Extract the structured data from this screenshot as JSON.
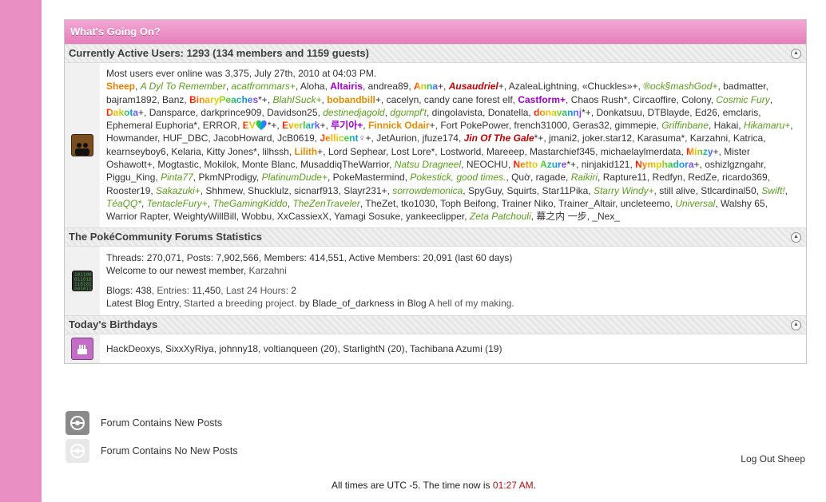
{
  "wgo": {
    "title": "What's Going On?",
    "active": {
      "header": "Currently Active Users: 1293 (134 members and 1159 guests)",
      "most_online": "Most users ever online was 3,375, July 27th, 2010 at 04:03 PM.",
      "users": [
        {
          "n": "Sheep",
          "s": "c-staff"
        },
        {
          "n": "A Dyl To Remember",
          "s": "c-green"
        },
        {
          "n": "acatfrommars+",
          "s": "c-green"
        },
        {
          "n": "Aloha",
          "s": "c-plain"
        },
        {
          "n": "Altairis",
          "s": "c-purple"
        },
        {
          "n": "andrea89",
          "s": "c-plain"
        },
        {
          "n": "Anna",
          "s": "rainbow",
          "x": "+"
        },
        {
          "n": "Ausaudriel",
          "s": "c-red",
          "x": "+"
        },
        {
          "n": "AzaleaLightning",
          "s": "c-plain"
        },
        {
          "n": "«Chuckles»+",
          "s": "c-plain"
        },
        {
          "n": "®ock§mashGod+",
          "s": "c-green"
        },
        {
          "n": "badmatter",
          "s": "c-plain"
        },
        {
          "n": "bajram1892",
          "s": "c-plain"
        },
        {
          "n": "Banz",
          "s": "c-plain"
        },
        {
          "n": "BinaryPeaches",
          "s": "rainbow",
          "x": "*+"
        },
        {
          "n": "BlahISuck+",
          "s": "c-green"
        },
        {
          "n": "bobandbill",
          "s": "c-orange",
          "x": "+"
        },
        {
          "n": "cacelyn",
          "s": "c-plain"
        },
        {
          "n": "candy cane forest elf",
          "s": "c-plain"
        },
        {
          "n": "Castform+",
          "s": "c-purple"
        },
        {
          "n": "Chaos Rush*",
          "s": "c-plain"
        },
        {
          "n": "Circaoffire",
          "s": "c-plain"
        },
        {
          "n": "Colony",
          "s": "c-plain"
        },
        {
          "n": "Cosmic Fury",
          "s": "c-green"
        },
        {
          "n": "Dakota",
          "s": "rainbow",
          "x": "+"
        },
        {
          "n": "Dansparce",
          "s": "c-plain"
        },
        {
          "n": "darkprince909",
          "s": "c-plain"
        },
        {
          "n": "Davidson25",
          "s": "c-plain"
        },
        {
          "n": "destinedjagold",
          "s": "c-green"
        },
        {
          "n": "dɡʊmpf't",
          "s": "c-green"
        },
        {
          "n": "dingolavista",
          "s": "c-plain"
        },
        {
          "n": "Donatella",
          "s": "c-plain"
        },
        {
          "n": "donavannj",
          "s": "rainbow",
          "x": "*+"
        },
        {
          "n": "Donkatsuu",
          "s": "c-plain"
        },
        {
          "n": "DTBlayde",
          "s": "c-plain"
        },
        {
          "n": "Ed26",
          "s": "c-plain"
        },
        {
          "n": "emclaris",
          "s": "c-plain"
        },
        {
          "n": "Ephemeral Euphoria*",
          "s": "c-plain"
        },
        {
          "n": "ERROR",
          "s": "c-plain"
        },
        {
          "n": "EV💚",
          "s": "rainbow",
          "x": "*+"
        },
        {
          "n": "Everlark",
          "s": "rainbow",
          "x": "+"
        },
        {
          "n": "루기아+",
          "s": "c-purple"
        },
        {
          "n": "Finnick Odair",
          "s": "c-orange",
          "x": "+"
        },
        {
          "n": "Fort PokePower",
          "s": "c-plain"
        },
        {
          "n": "french31000",
          "s": "c-plain"
        },
        {
          "n": "Geras32",
          "s": "c-plain"
        },
        {
          "n": "gimmepie",
          "s": "c-plain"
        },
        {
          "n": "Griffinbane",
          "s": "c-green"
        },
        {
          "n": "Hakai",
          "s": "c-plain"
        },
        {
          "n": "Hikamaru+",
          "s": "c-green"
        },
        {
          "n": "Howmander",
          "s": "c-plain"
        },
        {
          "n": "HUF_DBC",
          "s": "c-plain"
        },
        {
          "n": "JacobHoward",
          "s": "c-plain"
        },
        {
          "n": "JcB0619",
          "s": "c-plain"
        },
        {
          "n": "Jellicent♀",
          "s": "rainbow",
          "x": "+"
        },
        {
          "n": "JetAurion",
          "s": "c-plain"
        },
        {
          "n": "jfuze174",
          "s": "c-plain"
        },
        {
          "n": "Jin Of The Gale",
          "s": "c-red",
          "x": "*+"
        },
        {
          "n": "jmani2",
          "s": "c-plain"
        },
        {
          "n": "joker.star12",
          "s": "c-plain"
        },
        {
          "n": "Karasuma*",
          "s": "c-plain"
        },
        {
          "n": "Karzahni",
          "s": "c-plain"
        },
        {
          "n": "Katrica",
          "s": "c-plain"
        },
        {
          "n": "kearnseyboy6",
          "s": "c-plain"
        },
        {
          "n": "Kelaria",
          "s": "c-plain"
        },
        {
          "n": "Kitty Jones*",
          "s": "c-plain"
        },
        {
          "n": "lilhssh",
          "s": "c-plain"
        },
        {
          "n": "Lilith",
          "s": "c-orange",
          "x": "+"
        },
        {
          "n": "Lord Sephear",
          "s": "c-plain"
        },
        {
          "n": "Lost Lore*",
          "s": "c-plain"
        },
        {
          "n": "Lostworld",
          "s": "c-plain"
        },
        {
          "n": "Mareeep",
          "s": "c-plain"
        },
        {
          "n": "Mastarchief345",
          "s": "c-plain"
        },
        {
          "n": "michaelaylmerdata",
          "s": "c-plain"
        },
        {
          "n": "Minzy",
          "s": "rainbow",
          "x": "+"
        },
        {
          "n": "Mister Oshawott+",
          "s": "c-plain"
        },
        {
          "n": "Mogtastic",
          "s": "c-plain"
        },
        {
          "n": "Mokilok",
          "s": "c-plain"
        },
        {
          "n": "Monte Blanc",
          "s": "c-plain"
        },
        {
          "n": "MusaddiqTheWarrior",
          "s": "c-plain"
        },
        {
          "n": "Natsu Dragneel",
          "s": "c-green"
        },
        {
          "n": "NEOCHU",
          "s": "c-plain"
        },
        {
          "n": "Netto Azure",
          "s": "rainbow",
          "x": "*+"
        },
        {
          "n": "ninjakid121",
          "s": "c-plain"
        },
        {
          "n": "Nymphadora",
          "s": "rainbow",
          "x": "+"
        },
        {
          "n": "oshizlgzngahr",
          "s": "c-plain"
        },
        {
          "n": "Piggu_King",
          "s": "c-plain"
        },
        {
          "n": "Pinta77",
          "s": "c-green"
        },
        {
          "n": "PkmNProdigy",
          "s": "c-plain"
        },
        {
          "n": "PlatinumDude+",
          "s": "c-green"
        },
        {
          "n": "PokeMastermind",
          "s": "c-plain"
        },
        {
          "n": "Pokestick, good times.",
          "s": "c-green"
        },
        {
          "n": "Quờ",
          "s": "c-plain"
        },
        {
          "n": "ragade",
          "s": "c-plain"
        },
        {
          "n": "Raikiri",
          "s": "c-green"
        },
        {
          "n": "Rapture11",
          "s": "c-plain"
        },
        {
          "n": "Redfyn",
          "s": "c-plain"
        },
        {
          "n": "RedZe",
          "s": "c-plain"
        },
        {
          "n": "ricardo369",
          "s": "c-plain"
        },
        {
          "n": "Rooster19",
          "s": "c-plain"
        },
        {
          "n": "Sakazuki+",
          "s": "c-green"
        },
        {
          "n": "Shhmew",
          "s": "c-plain"
        },
        {
          "n": "Shucklulz",
          "s": "c-plain"
        },
        {
          "n": "sicnarf913",
          "s": "c-plain"
        },
        {
          "n": "Slayr231+",
          "s": "c-plain"
        },
        {
          "n": "sorrowdemonica",
          "s": "c-green"
        },
        {
          "n": "SpyGuy",
          "s": "c-plain"
        },
        {
          "n": "Squirts",
          "s": "c-plain"
        },
        {
          "n": "Star11Pika",
          "s": "c-plain"
        },
        {
          "n": "Starry Windy+",
          "s": "c-green"
        },
        {
          "n": "still alive",
          "s": "c-plain"
        },
        {
          "n": "Stlcardinal50",
          "s": "c-plain"
        },
        {
          "n": "Swift!",
          "s": "c-green"
        },
        {
          "n": "TéaQQ*",
          "s": "c-green"
        },
        {
          "n": "TentacleFury+",
          "s": "c-green"
        },
        {
          "n": "TheGamingKiddo",
          "s": "c-green"
        },
        {
          "n": "TheZenTraveler",
          "s": "c-green"
        },
        {
          "n": "TheZet",
          "s": "c-plain"
        },
        {
          "n": "tko1030",
          "s": "c-plain"
        },
        {
          "n": "Toph Beifong",
          "s": "c-plain"
        },
        {
          "n": "Trainer Niko",
          "s": "c-plain"
        },
        {
          "n": "Trainer_Altair",
          "s": "c-plain"
        },
        {
          "n": "uncleteemo",
          "s": "c-plain"
        },
        {
          "n": "Universal",
          "s": "c-green"
        },
        {
          "n": "Walshy 65",
          "s": "c-plain"
        },
        {
          "n": "Warrior Rapter",
          "s": "c-plain"
        },
        {
          "n": "WeightyWillBill",
          "s": "c-plain"
        },
        {
          "n": "Wobbu",
          "s": "c-plain"
        },
        {
          "n": "XxCassiexX",
          "s": "c-plain"
        },
        {
          "n": "Yamagi Sosuke",
          "s": "c-plain"
        },
        {
          "n": "yankeeclipper",
          "s": "c-plain"
        },
        {
          "n": "Zeta Patchouli",
          "s": "c-green"
        },
        {
          "n": "幕之内 一步",
          "s": "c-plain"
        },
        {
          "n": "_Nex_",
          "s": "c-plain"
        }
      ]
    },
    "stats": {
      "header": "The PokéCommunity Forums Statistics",
      "threads_label": "Threads: ",
      "threads": "270,071",
      "posts_label": ", Posts: ",
      "posts": "7,902,566",
      "members_label": ", Members: ",
      "members": "414,551",
      "active_label": ", Active Members: ",
      "active": "20,091",
      "active_suffix": " (last 60 days)",
      "welcome_prefix": "Welcome to our newest member, ",
      "newest_member": "Karzahni",
      "blogs_label": "Blogs: ",
      "blogs": "438",
      "entries_label": ", Entries: ",
      "entries": "11,450",
      "last24_label": ", Last 24 Hours: ",
      "last24": "2",
      "latest_prefix": "Latest Blog Entry, ",
      "latest_title": "Started a breeding project.",
      "by": " by ",
      "latest_author": "Blade_of_darkness",
      "in_blog": " in Blog ",
      "blog_name": "A hell of my making."
    },
    "birthdays": {
      "header": "Today's Birthdays",
      "items": [
        {
          "name": "HackDeoxys",
          "age": ""
        },
        {
          "name": "SixxXyRiya",
          "age": ""
        },
        {
          "name": "johnny18",
          "age": ""
        },
        {
          "name": "voltianqueen",
          "age": "(20)"
        },
        {
          "name": "StarlightN",
          "age": "(20)"
        },
        {
          "name": "Tachibana Azumi",
          "age": "(19)"
        }
      ]
    }
  },
  "legend": {
    "new_posts": "Forum Contains New Posts",
    "no_new_posts": "Forum Contains No New Posts"
  },
  "logout": "Log Out Sheep",
  "footer": {
    "prefix": "All times are UTC -5. The time now is ",
    "time": "01:27 AM",
    "suffix": "."
  },
  "icons": {
    "users": "users-icon",
    "stats": "stats-icon",
    "birthday": "birthday-cake-icon",
    "collapse": "collapse-icon",
    "new_posts": "pokeball-new-icon",
    "no_new_posts": "pokeball-old-icon"
  },
  "colors": {
    "header_pink": "#e98fc3",
    "time_red": "#b01010",
    "staff_orange": "#e67e00",
    "member_green": "#5a9e1a"
  }
}
